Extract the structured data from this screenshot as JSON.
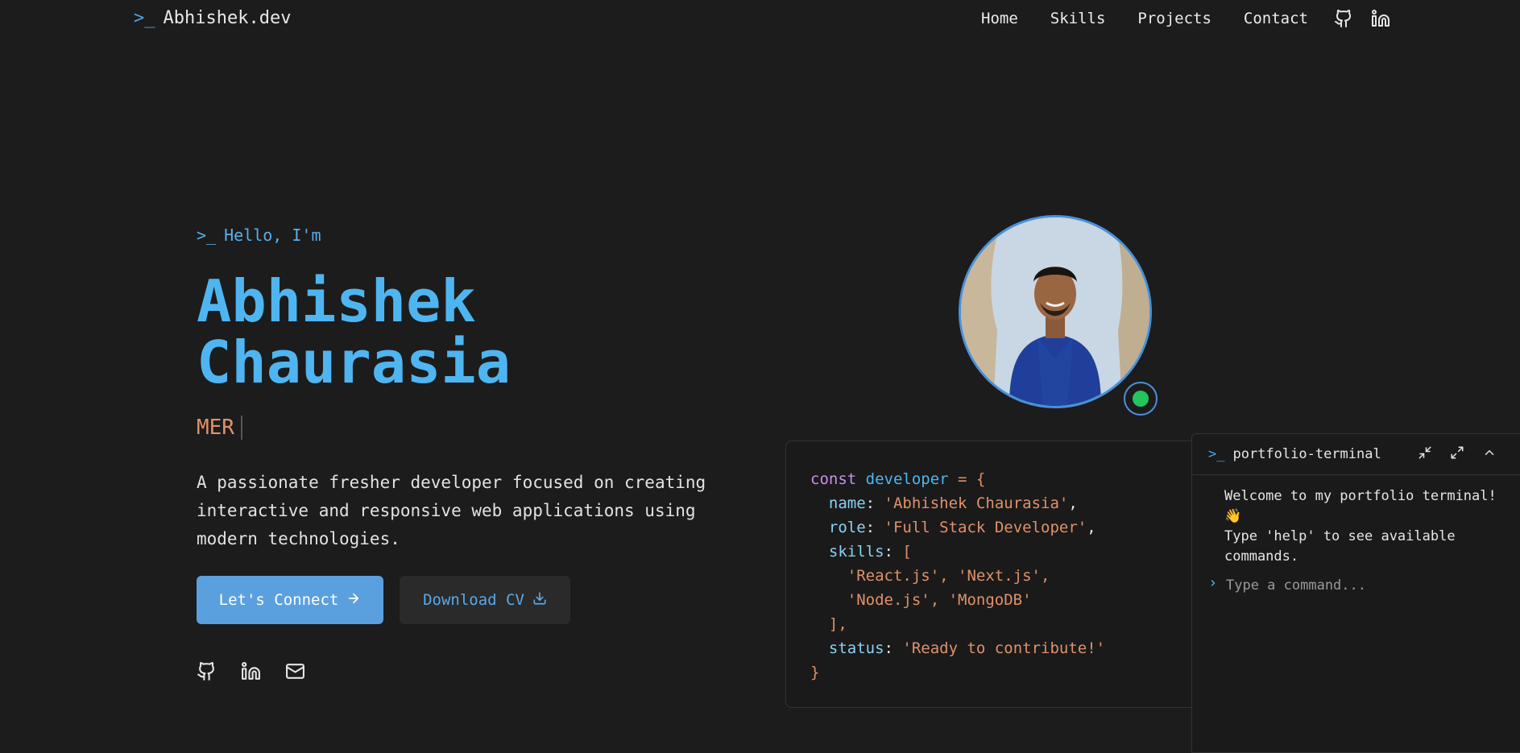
{
  "nav": {
    "logo_prompt": ">_",
    "logo_text": "Abhishek.dev",
    "links": [
      "Home",
      "Skills",
      "Projects",
      "Contact"
    ],
    "icons": [
      "github-icon",
      "linkedin-icon"
    ]
  },
  "hero": {
    "greeting_prompt": ">_",
    "greeting": "Hello, I'm",
    "name_line1": "Abhishek",
    "name_line2": "Chaurasia",
    "typed_role": "MER",
    "description": "A passionate fresher developer focused on creating interactive and responsive web applications using modern technologies.",
    "primary_button": "Let's Connect",
    "secondary_button": "Download CV",
    "social_icons": [
      "github-icon",
      "linkedin-icon",
      "mail-icon"
    ]
  },
  "code_card": {
    "lines": [
      {
        "kw": "const",
        "var": "developer",
        "rest": " = {"
      },
      {
        "key": "name",
        "val": "'Abhishek Chaurasia'"
      },
      {
        "key": "role",
        "val": "'Full Stack Developer'"
      },
      {
        "key": "skills",
        "open": "["
      },
      {
        "items": "'React.js', 'Next.js',"
      },
      {
        "items2": "'Node.js', 'MongoDB'"
      },
      {
        "close": "],"
      },
      {
        "key": "status",
        "val": "'Ready to contribute!'"
      },
      {
        "end": "}"
      }
    ]
  },
  "terminal": {
    "prompt": ">_",
    "title": "portfolio-terminal",
    "welcome": "Welcome to my portfolio terminal!",
    "wave": "👋",
    "help": "Type 'help' to see available commands.",
    "input_placeholder": "Type a command...",
    "controls": [
      "minimize-icon",
      "maximize-icon",
      "chevron-up-icon"
    ]
  },
  "colors": {
    "background": "#1c1c1c",
    "accent": "#4fb5f0",
    "primary_button": "#5ba0de",
    "role_text": "#e0916a",
    "online_status": "#22c55e"
  }
}
